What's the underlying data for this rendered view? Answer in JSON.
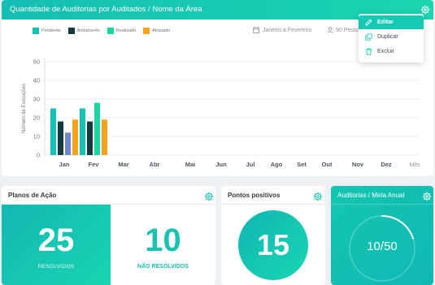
{
  "chart_card": {
    "title": "Quantidade de Auditorias por Auditados / Nome da Área",
    "period_label": "Janeiro a Fevereiro",
    "people_label": "90 Pessoa"
  },
  "colors": {
    "primary": "#16c9b2",
    "pendente": "#16c2b6",
    "andamento": "#153a3f",
    "realizado": "#1ad6a3",
    "atrasado": "#f7a21c",
    "extra": "#6f86c9"
  },
  "context_menu": {
    "items": [
      {
        "label": "Editar",
        "icon": "pencil-icon"
      },
      {
        "label": "Duplicar",
        "icon": "duplicate-icon"
      },
      {
        "label": "Excluir",
        "icon": "trash-icon"
      }
    ]
  },
  "chart_data": {
    "type": "bar",
    "title": "Quantidade de Auditorias por Auditados / Nome da Área",
    "xlabel": "Mês",
    "ylabel": "Número de Execuções",
    "ylim": [
      0,
      50
    ],
    "yticks": [
      0,
      10,
      20,
      30,
      40,
      50
    ],
    "grid": true,
    "legend_position": "top-left",
    "categories": [
      "Jan",
      "Fev",
      "Mar",
      "Abr",
      "Mai",
      "Jun",
      "Jul",
      "Ago",
      "Set",
      "Out",
      "Nov",
      "Dez"
    ],
    "series": [
      {
        "name": "Pendente",
        "color": "#16c2b6",
        "values": [
          25,
          25,
          0,
          0,
          0,
          0,
          0,
          0,
          0,
          0,
          0,
          0
        ]
      },
      {
        "name": "Andamento",
        "color": "#153a3f",
        "values": [
          18,
          18,
          0,
          0,
          0,
          0,
          0,
          0,
          0,
          0,
          0,
          0
        ]
      },
      {
        "name": "Realizado",
        "color": "#1ad6a3",
        "values": [
          12,
          28,
          0,
          0,
          0,
          0,
          0,
          0,
          0,
          0,
          0,
          0
        ]
      },
      {
        "name": "Atrasado",
        "color": "#f7a21c",
        "values": [
          19,
          19,
          0,
          0,
          0,
          0,
          0,
          0,
          0,
          0,
          0,
          0
        ]
      }
    ],
    "extra_bar": {
      "category": "Jan",
      "value": 12,
      "color": "#6f86c9"
    }
  },
  "planos": {
    "title": "Planos de Ação",
    "resolved_value": "25",
    "resolved_label": "RESOLVIDOS",
    "unresolved_value": "10",
    "unresolved_label": "NÃO RESOLVIDOS"
  },
  "pontos": {
    "title": "Pontos positivos",
    "value": "15"
  },
  "meta": {
    "title": "Auditorias / Meta Anual",
    "value_text": "10/50",
    "current": 10,
    "target": 50
  }
}
